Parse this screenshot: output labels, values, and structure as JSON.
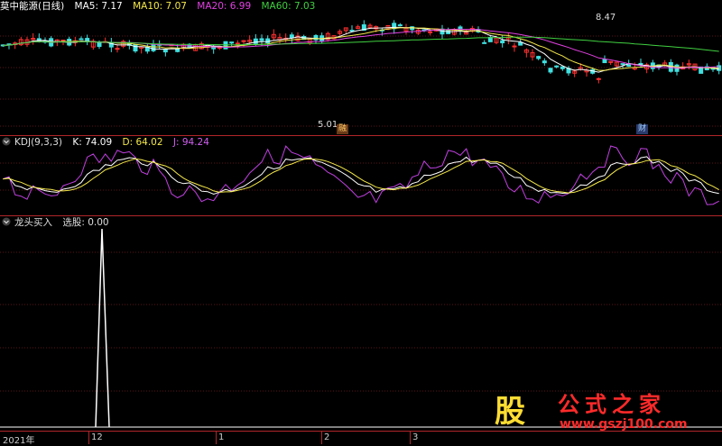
{
  "main": {
    "title": "莫中能源(日线)",
    "ma": [
      {
        "label": "MA5: 7.17",
        "color": "#ffffff"
      },
      {
        "label": "MA10: 7.07",
        "color": "#f4e84a"
      },
      {
        "label": "MA20: 6.99",
        "color": "#e040e0"
      },
      {
        "label": "MA60: 7.03",
        "color": "#40d040"
      }
    ],
    "high_label": "8.47",
    "low_label": "5.01",
    "badge_1": "融",
    "badge_2": "财"
  },
  "kdj": {
    "title": "KDJ(9,3,3)",
    "k": "K: 74.09",
    "d": "D: 64.02",
    "j": "J: 94.24",
    "colors": {
      "k": "#ffffff",
      "d": "#f4e84a",
      "j": "#c040e0"
    }
  },
  "indicator": {
    "title": "龙头买入",
    "value": "选股: 0.00"
  },
  "axis": {
    "labels": [
      "2021年",
      "12",
      "1",
      "2",
      "3"
    ]
  },
  "watermark": {
    "glyph": "股",
    "title": "公式之家",
    "url": "www.gszj100.com"
  }
}
